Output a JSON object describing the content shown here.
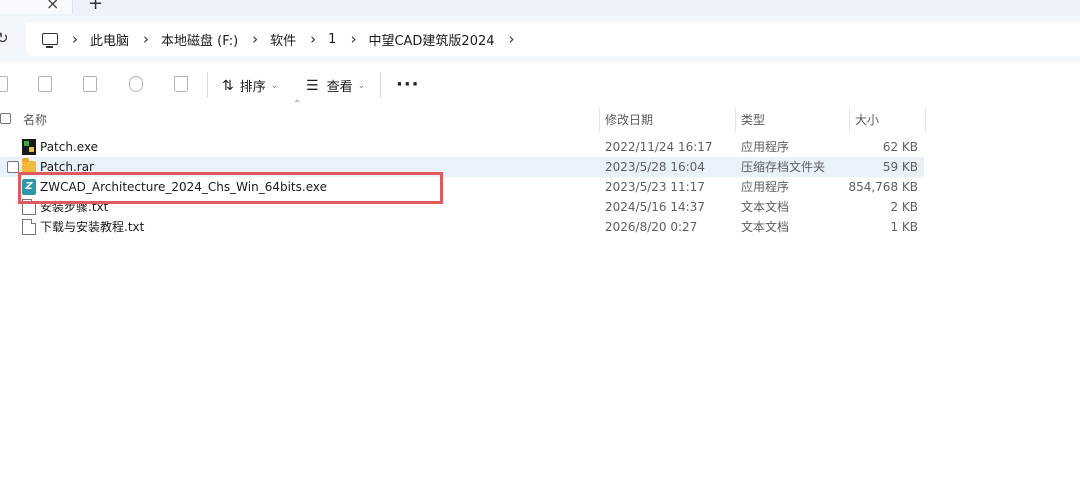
{
  "tabstrip": {
    "close_glyph": "×",
    "new_tab_glyph": "+"
  },
  "address": {
    "refresh_glyph": "↻",
    "separator_glyph": "›",
    "breadcrumbs": [
      "此电脑",
      "本地磁盘 (F:)",
      "软件",
      "1",
      "中望CAD建筑版2024"
    ]
  },
  "toolbar": {
    "sort_label": "排序",
    "view_label": "查看",
    "chevron_glyph": "⌄",
    "more_glyph": "···",
    "sort_icon_glyph": "⇅",
    "view_icon_glyph": "☰"
  },
  "columns": {
    "name": "名称",
    "date": "修改日期",
    "type": "类型",
    "size": "大小",
    "sort_glyph": "⌃"
  },
  "files": [
    {
      "name": "Patch.exe",
      "date": "2022/11/24 16:17",
      "type": "应用程序",
      "size": "62 KB",
      "icon": "exe-icon"
    },
    {
      "name": "Patch.rar",
      "date": "2023/5/28 16:04",
      "type": "压缩存档文件夹",
      "size": "59 KB",
      "icon": "rar-folder-icon"
    },
    {
      "name": "ZWCAD_Architecture_2024_Chs_Win_64bits.exe",
      "date": "2023/5/23 11:17",
      "type": "应用程序",
      "size": "854,768 KB",
      "icon": "zwcad-icon"
    },
    {
      "name": "安装步骤.txt",
      "date": "2024/5/16 14:37",
      "type": "文本文档",
      "size": "2 KB",
      "icon": "text-file-icon"
    },
    {
      "name": "下载与安装教程.txt",
      "date": "2026/8/20 0:27",
      "type": "文本文档",
      "size": "1 KB",
      "icon": "text-file-icon"
    }
  ],
  "zw_icon_glyph": "Z",
  "colors": {
    "highlight_box": "#e0595f",
    "selected_row": "#e9f1fb",
    "address_bar_bg": "#f3f6fb"
  }
}
